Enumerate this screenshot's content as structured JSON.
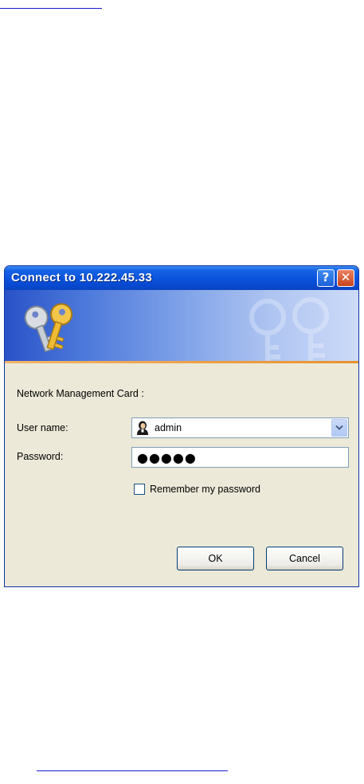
{
  "dialog": {
    "title": "Connect to 10.222.45.33",
    "help_button_glyph": "?",
    "close_button_glyph": "✕",
    "realm_text": "Network Management Card :",
    "username_label": "User name:",
    "username_value": "admin",
    "password_label": "Password:",
    "password_masked": "●●●●●",
    "remember_label": "Remember my password",
    "remember_checked": false,
    "ok_label": "OK",
    "cancel_label": "Cancel"
  },
  "icons": {
    "banner": "keys-icon",
    "user": "user-icon",
    "dropdown": "chevron-down-icon"
  },
  "colors": {
    "titlebar": "#0a52dc",
    "dialog_bg": "#ece9d8",
    "close_button": "#c6441d",
    "accent_line": "#e8912e",
    "link_rule": "#1b1bd6"
  }
}
